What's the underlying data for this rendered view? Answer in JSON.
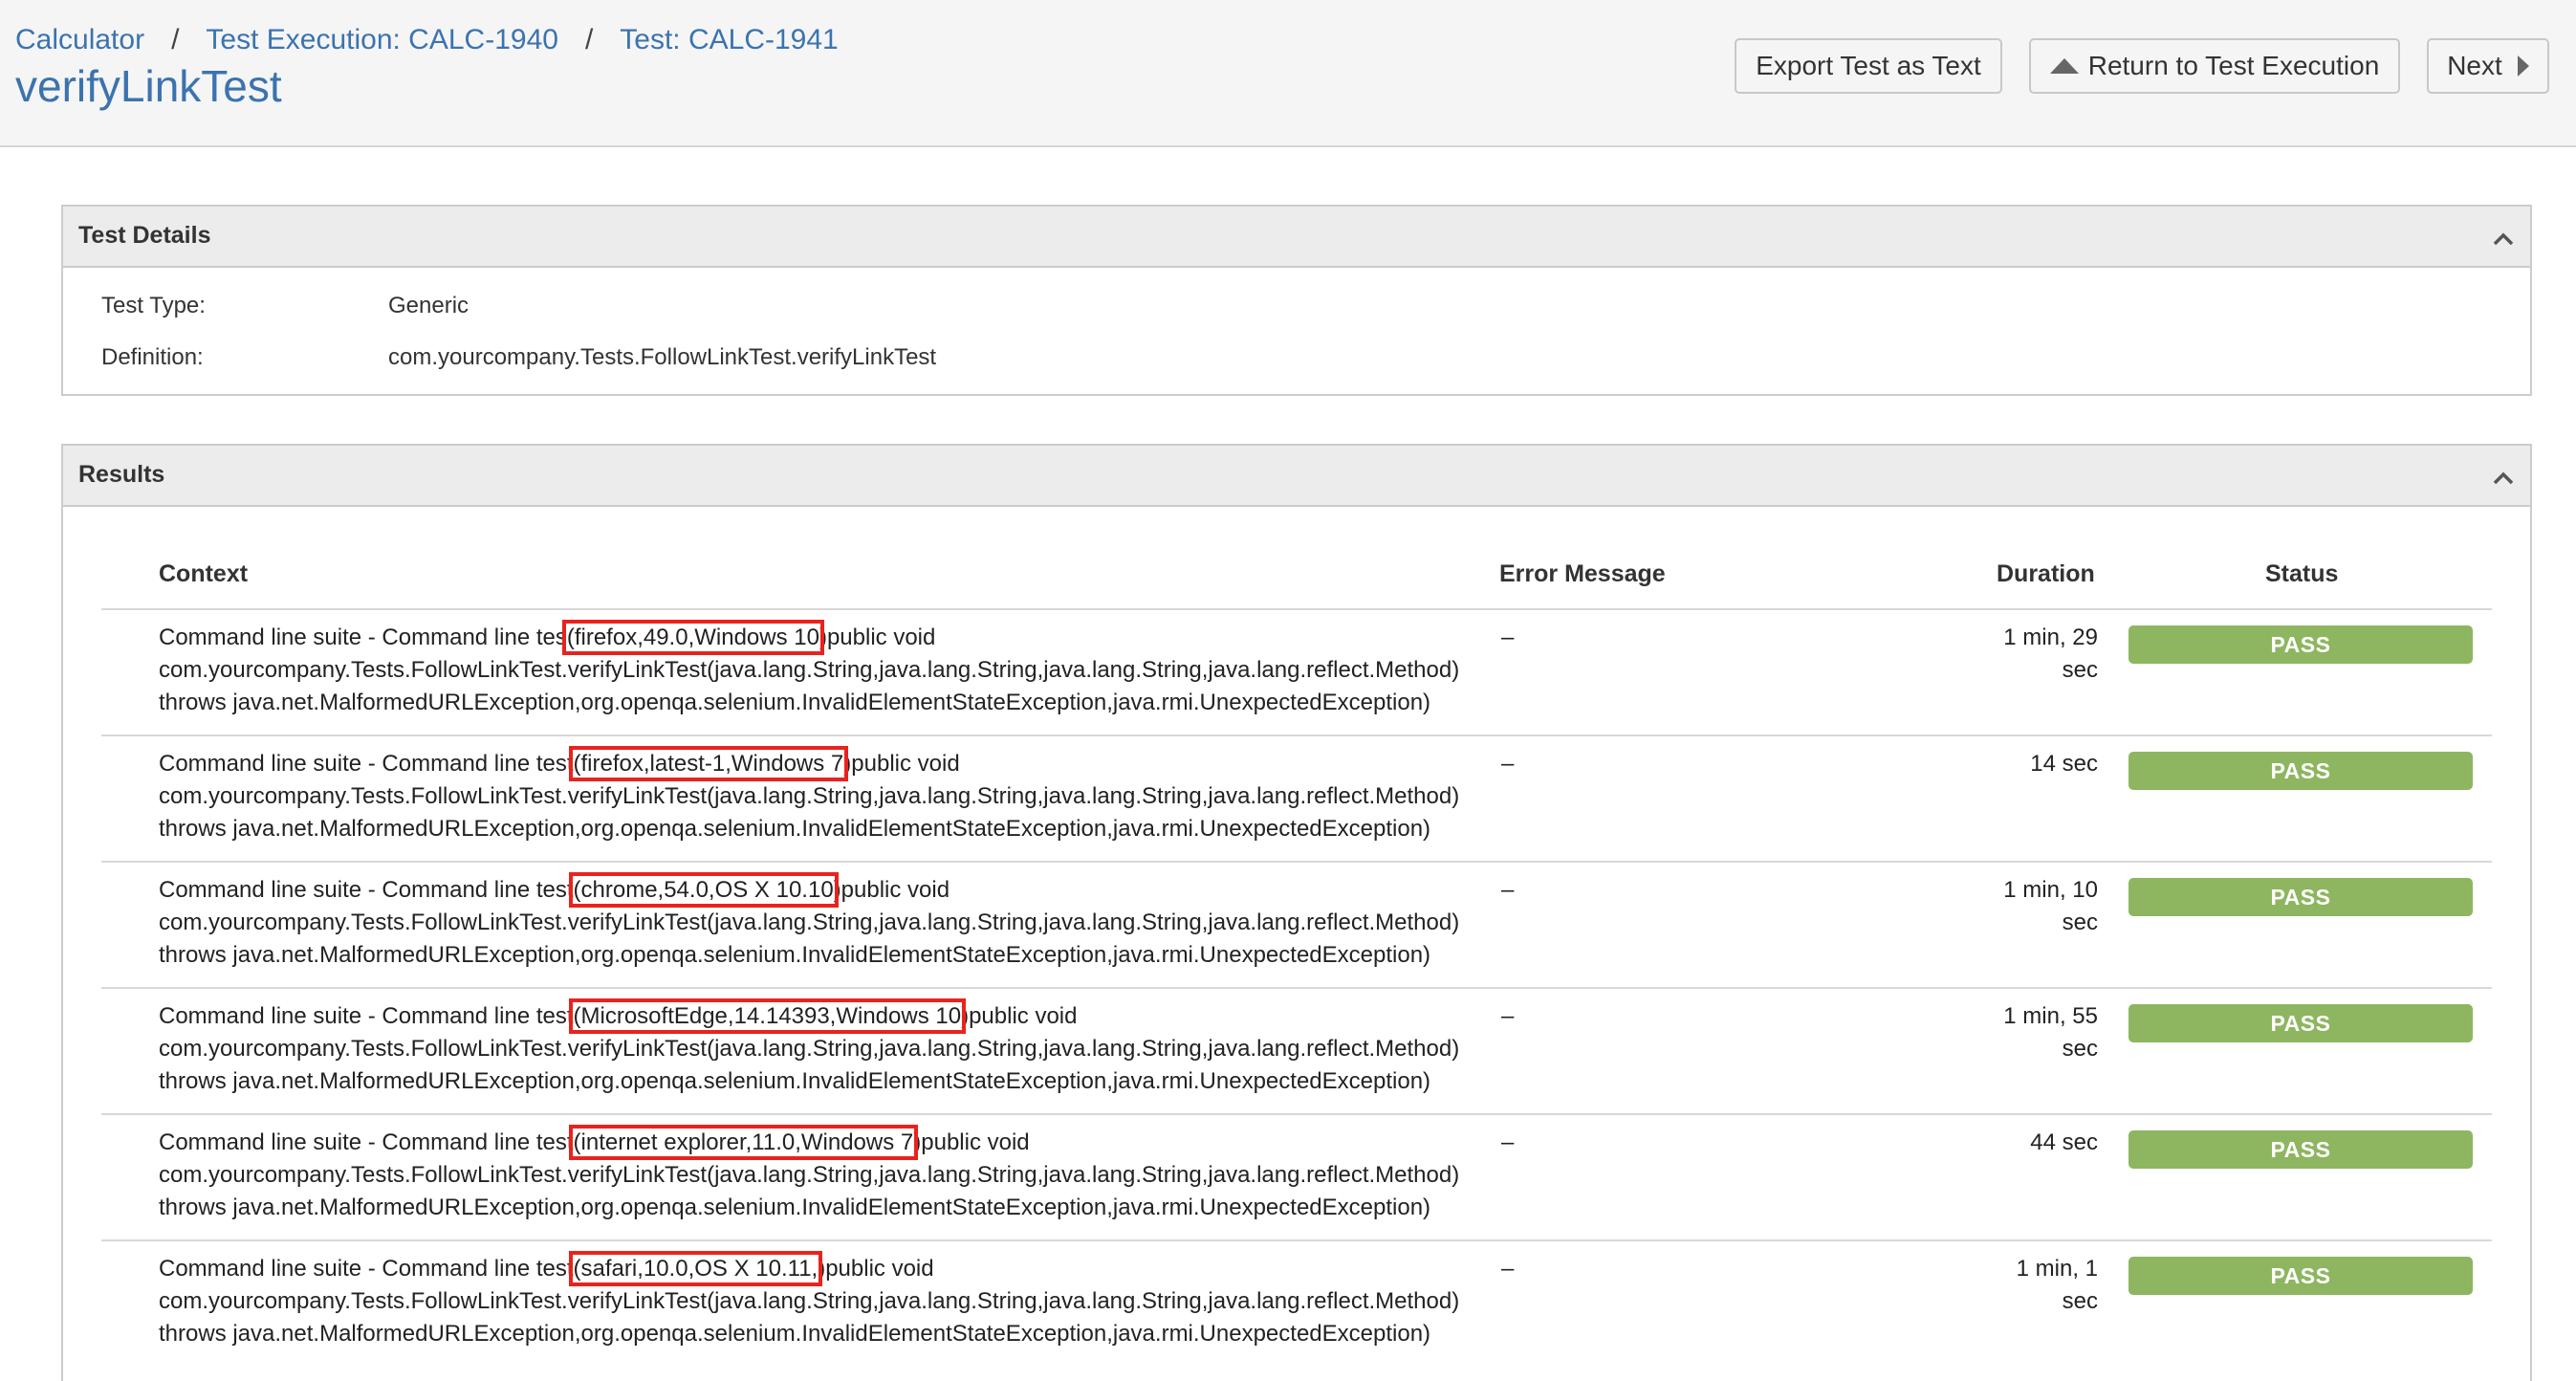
{
  "breadcrumb": {
    "project": "Calculator",
    "execution": "Test Execution: CALC-1940",
    "test": "Test: CALC-1941",
    "separator": "/"
  },
  "page_title": "verifyLinkTest",
  "toolbar": {
    "export_label": "Export Test as Text",
    "return_label": "Return to Test Execution",
    "next_label": "Next"
  },
  "test_details": {
    "title": "Test Details",
    "type_label": "Test Type:",
    "type_value": "Generic",
    "definition_label": "Definition:",
    "definition_value": "com.yourcompany.Tests.FollowLinkTest.verifyLinkTest"
  },
  "results": {
    "title": "Results",
    "headers": {
      "context": "Context",
      "error": "Error Message",
      "duration": "Duration",
      "status": "Status"
    },
    "rows": [
      {
        "prefix": "Command line suite - Command line tes",
        "highlight": "(firefox,49.0,Windows 10",
        "suffix": ")public void",
        "line2": "com.yourcompany.Tests.FollowLinkTest.verifyLinkTest(java.lang.String,java.lang.String,java.lang.String,java.lang.reflect.Method)",
        "line3": "throws java.net.MalformedURLException,org.openqa.selenium.InvalidElementStateException,java.rmi.UnexpectedException)",
        "error": "–",
        "duration_1": "1 min, 29",
        "duration_2": "sec",
        "status": "PASS"
      },
      {
        "prefix": "Command line suite - Command line test",
        "highlight": "(firefox,latest-1,Windows 7",
        "suffix": ")public void",
        "line2": "com.yourcompany.Tests.FollowLinkTest.verifyLinkTest(java.lang.String,java.lang.String,java.lang.String,java.lang.reflect.Method)",
        "line3": "throws java.net.MalformedURLException,org.openqa.selenium.InvalidElementStateException,java.rmi.UnexpectedException)",
        "error": "–",
        "duration_1": "14 sec",
        "duration_2": "",
        "status": "PASS"
      },
      {
        "prefix": "Command line suite - Command line test",
        "highlight": "(chrome,54.0,OS X 10.10",
        "suffix": ")public void",
        "line2": "com.yourcompany.Tests.FollowLinkTest.verifyLinkTest(java.lang.String,java.lang.String,java.lang.String,java.lang.reflect.Method)",
        "line3": "throws java.net.MalformedURLException,org.openqa.selenium.InvalidElementStateException,java.rmi.UnexpectedException)",
        "error": "–",
        "duration_1": "1 min, 10",
        "duration_2": "sec",
        "status": "PASS"
      },
      {
        "prefix": "Command line suite - Command line test",
        "highlight": "(MicrosoftEdge,14.14393,Windows 10",
        "suffix": ")public void",
        "line2": "com.yourcompany.Tests.FollowLinkTest.verifyLinkTest(java.lang.String,java.lang.String,java.lang.String,java.lang.reflect.Method)",
        "line3": "throws java.net.MalformedURLException,org.openqa.selenium.InvalidElementStateException,java.rmi.UnexpectedException)",
        "error": "–",
        "duration_1": "1 min, 55",
        "duration_2": "sec",
        "status": "PASS"
      },
      {
        "prefix": "Command line suite - Command line test",
        "highlight": "(internet explorer,11.0,Windows 7",
        "suffix": ")public void",
        "line2": "com.yourcompany.Tests.FollowLinkTest.verifyLinkTest(java.lang.String,java.lang.String,java.lang.String,java.lang.reflect.Method)",
        "line3": "throws java.net.MalformedURLException,org.openqa.selenium.InvalidElementStateException,java.rmi.UnexpectedException)",
        "error": "–",
        "duration_1": "44 sec",
        "duration_2": "",
        "status": "PASS"
      },
      {
        "prefix": "Command line suite - Command line test",
        "highlight": "(safari,10.0,OS X 10.11,",
        "suffix": ")public void",
        "line2": "com.yourcompany.Tests.FollowLinkTest.verifyLinkTest(java.lang.String,java.lang.String,java.lang.String,java.lang.reflect.Method)",
        "line3": "throws java.net.MalformedURLException,org.openqa.selenium.InvalidElementStateException,java.rmi.UnexpectedException)",
        "error": "–",
        "duration_1": "1 min, 1",
        "duration_2": "sec",
        "status": "PASS"
      }
    ]
  },
  "colors": {
    "link": "#3b73af",
    "pass": "#8eb660",
    "highlight_box": "#e8231e",
    "panel_header": "#ececec"
  }
}
